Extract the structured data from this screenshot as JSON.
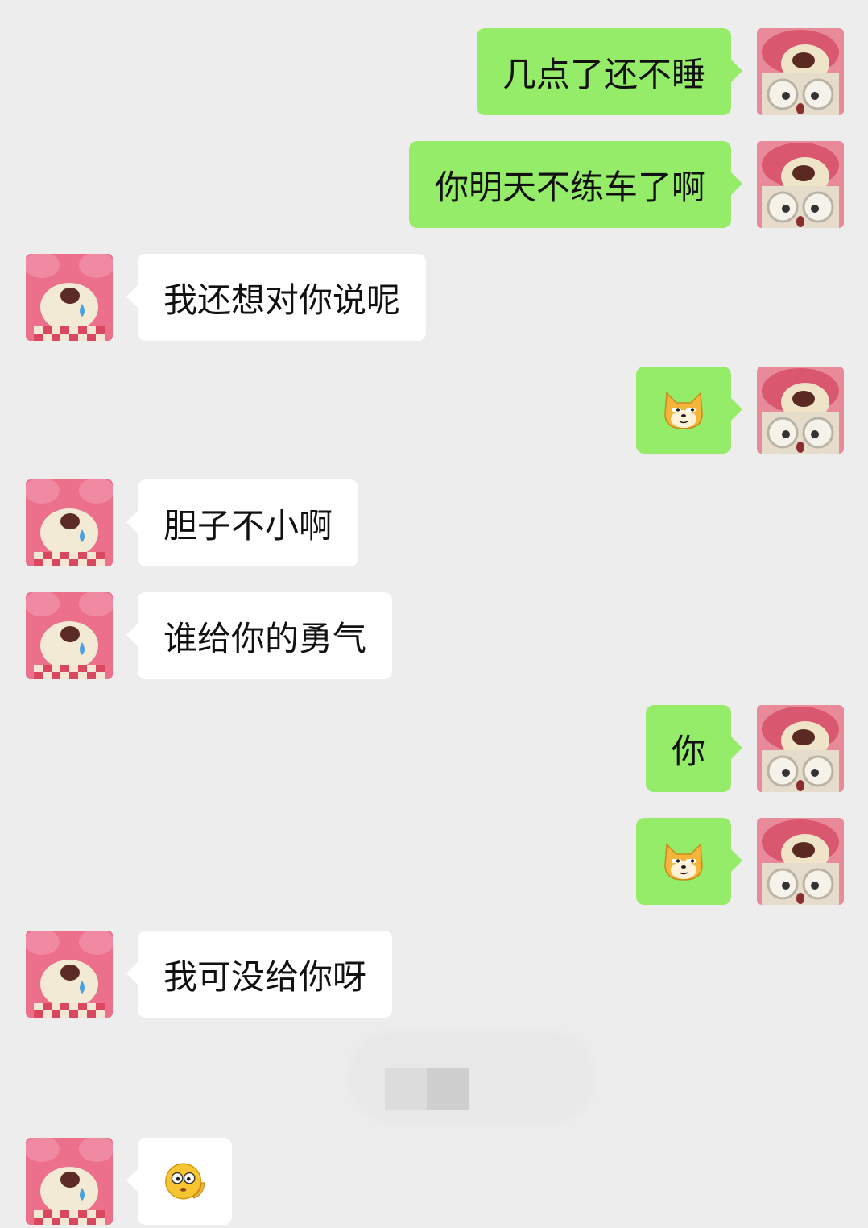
{
  "messages": [
    {
      "side": "right",
      "text": "几点了还不睡"
    },
    {
      "side": "right",
      "text": "你明天不练车了啊"
    },
    {
      "side": "left",
      "text": "我还想对你说呢"
    },
    {
      "side": "right",
      "emoji": "smirk-dog-emoji"
    },
    {
      "side": "left",
      "text": "胆子不小啊"
    },
    {
      "side": "left",
      "text": "谁给你的勇气"
    },
    {
      "side": "right",
      "text": "你"
    },
    {
      "side": "right",
      "emoji": "smirk-dog-emoji"
    },
    {
      "side": "left",
      "text": "我可没给你呀"
    },
    {
      "side": "left",
      "emoji": "thinking-face-emoji"
    }
  ],
  "colors": {
    "background": "#ededed",
    "sent_bubble": "#95ec69",
    "received_bubble": "#ffffff"
  },
  "avatars": {
    "self": "bear-with-glasses-avatar",
    "contact": "pink-bear-crying-avatar"
  }
}
